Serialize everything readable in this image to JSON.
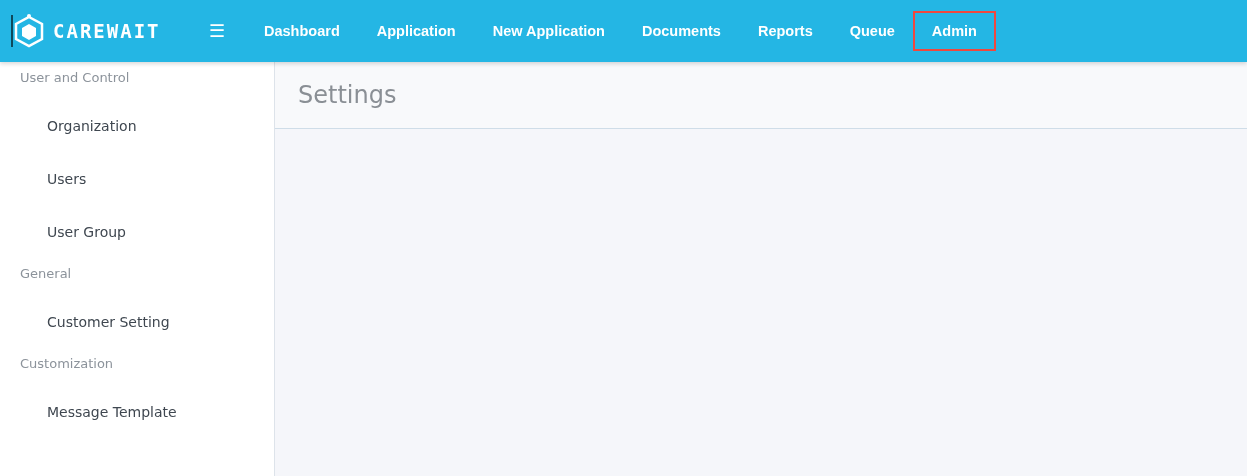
{
  "brand": "CAREWAIT",
  "menu_glyph": "☰",
  "nav": [
    {
      "label": "Dashboard",
      "selected": false
    },
    {
      "label": "Application",
      "selected": false
    },
    {
      "label": "New Application",
      "selected": false
    },
    {
      "label": "Documents",
      "selected": false
    },
    {
      "label": "Reports",
      "selected": false
    },
    {
      "label": "Queue",
      "selected": false
    },
    {
      "label": "Admin",
      "selected": true
    }
  ],
  "sidebar": [
    {
      "heading": "User and Control",
      "items": [
        "Organization",
        "Users",
        "User Group"
      ]
    },
    {
      "heading": "General",
      "items": [
        "Customer Setting"
      ]
    },
    {
      "heading": "Customization",
      "items": [
        "Message Template"
      ]
    }
  ],
  "page_title": "Settings"
}
